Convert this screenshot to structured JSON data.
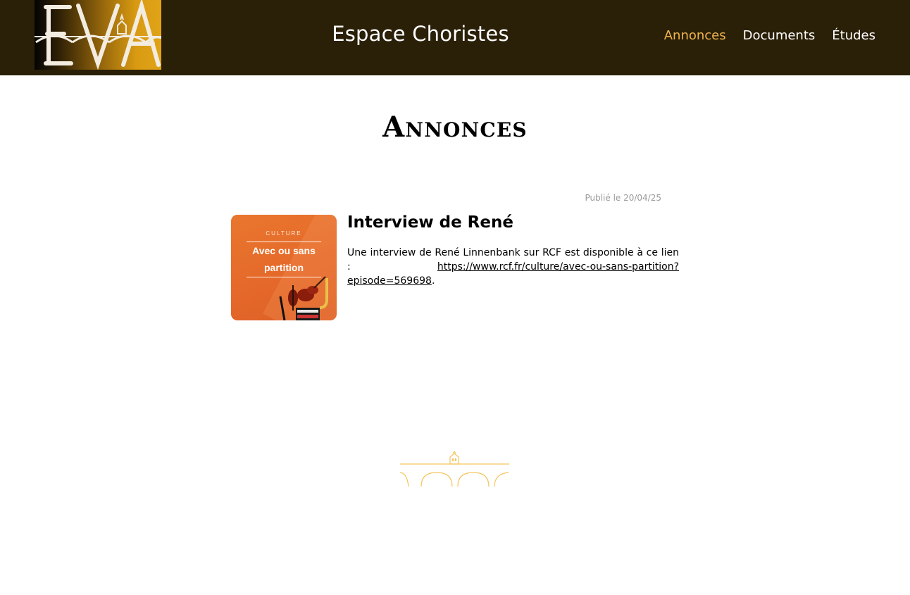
{
  "header": {
    "logo_text": "EVA",
    "site_title": "Espace Choristes",
    "nav": [
      {
        "label": "Annonces",
        "active": true
      },
      {
        "label": "Documents",
        "active": false
      },
      {
        "label": "Études",
        "active": false
      }
    ]
  },
  "main": {
    "page_title": "Annonces",
    "post": {
      "published": "Publié le 20/04/25",
      "title": "Interview de René",
      "body_text": "Une interview de René Linnenbank sur RCF est disponible à ce lien :",
      "link_text": "https://www.rcf.fr/culture/avec-ou-sans-partition?episode=569698",
      "body_end": ".",
      "thumbnail": {
        "kicker": "CULTURE",
        "line1": "Avec ou sans",
        "line2": "partition"
      }
    }
  },
  "colors": {
    "header_bg": "#2a1f07",
    "nav_active": "#f0b54d",
    "accent_gold": "#f5c55e",
    "thumbnail_orange": "#e9772e"
  }
}
